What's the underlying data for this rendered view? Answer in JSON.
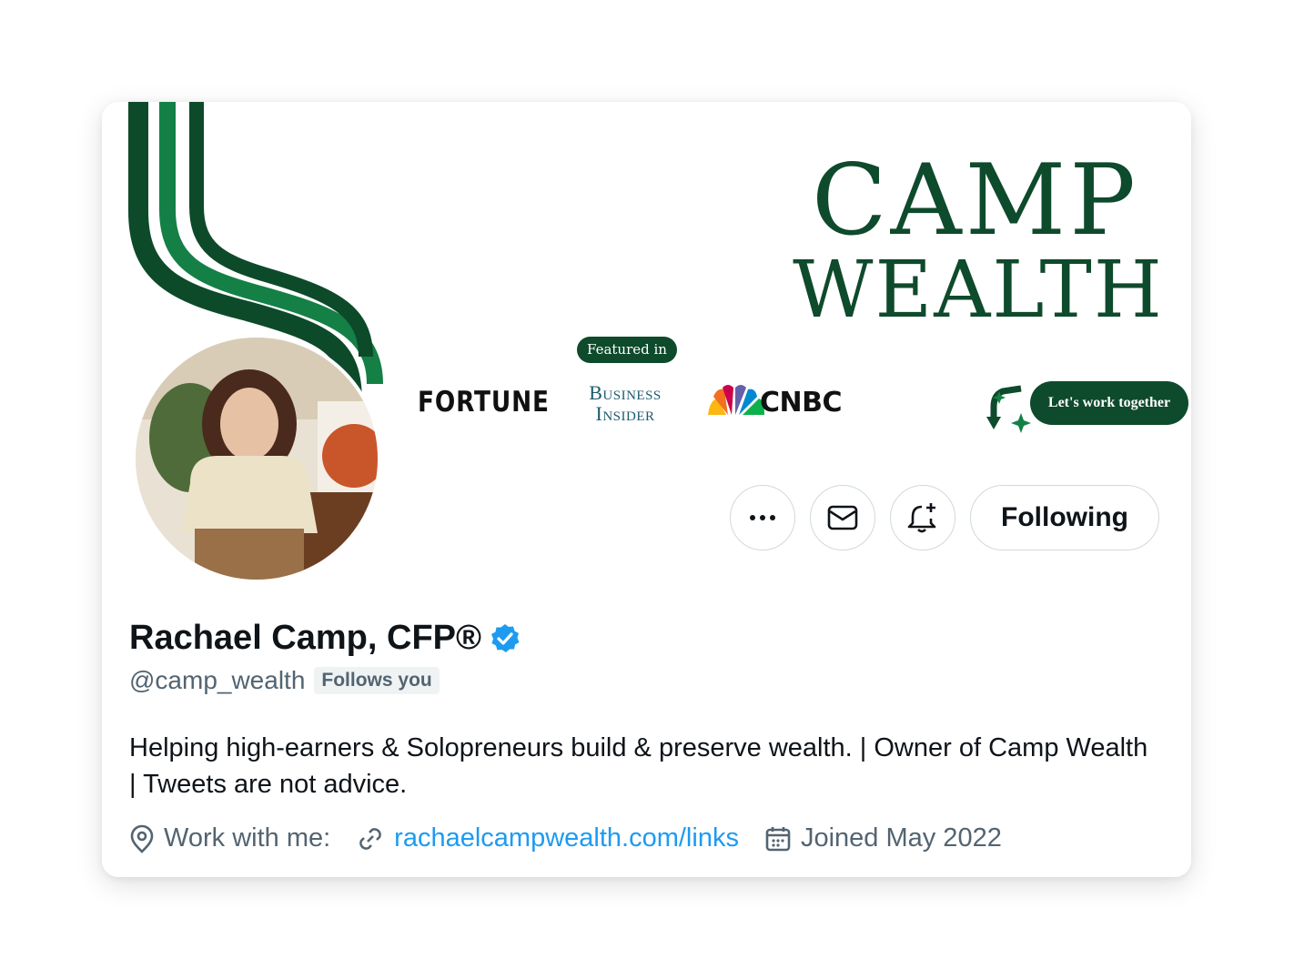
{
  "banner": {
    "brand_line1": "CAMP",
    "brand_line2": "WEALTH",
    "featured_label": "Featured in",
    "press": [
      "FORTUNE",
      "BUSINESS INSIDER",
      "CNBC"
    ],
    "press_bi_line1": "Business",
    "press_bi_line2": "Insider",
    "cta": "Let's work together",
    "brand_color": "#0e4a2c"
  },
  "actions": {
    "more_icon": "more-dots-icon",
    "message_icon": "envelope-icon",
    "notify_icon": "bell-plus-icon",
    "following_label": "Following"
  },
  "profile": {
    "name": "Rachael Camp, CFP®",
    "verified_icon": "verified-badge-icon",
    "verified_color": "#1d9bf0",
    "handle": "@camp_wealth",
    "follows_you": "Follows you",
    "bio": "Helping high-earners & Solopreneurs build & preserve wealth. | Owner of Camp Wealth | Tweets are not advice.",
    "location": "Work with me:",
    "website": "rachaelcampwealth.com/links",
    "joined": "Joined May 2022"
  }
}
